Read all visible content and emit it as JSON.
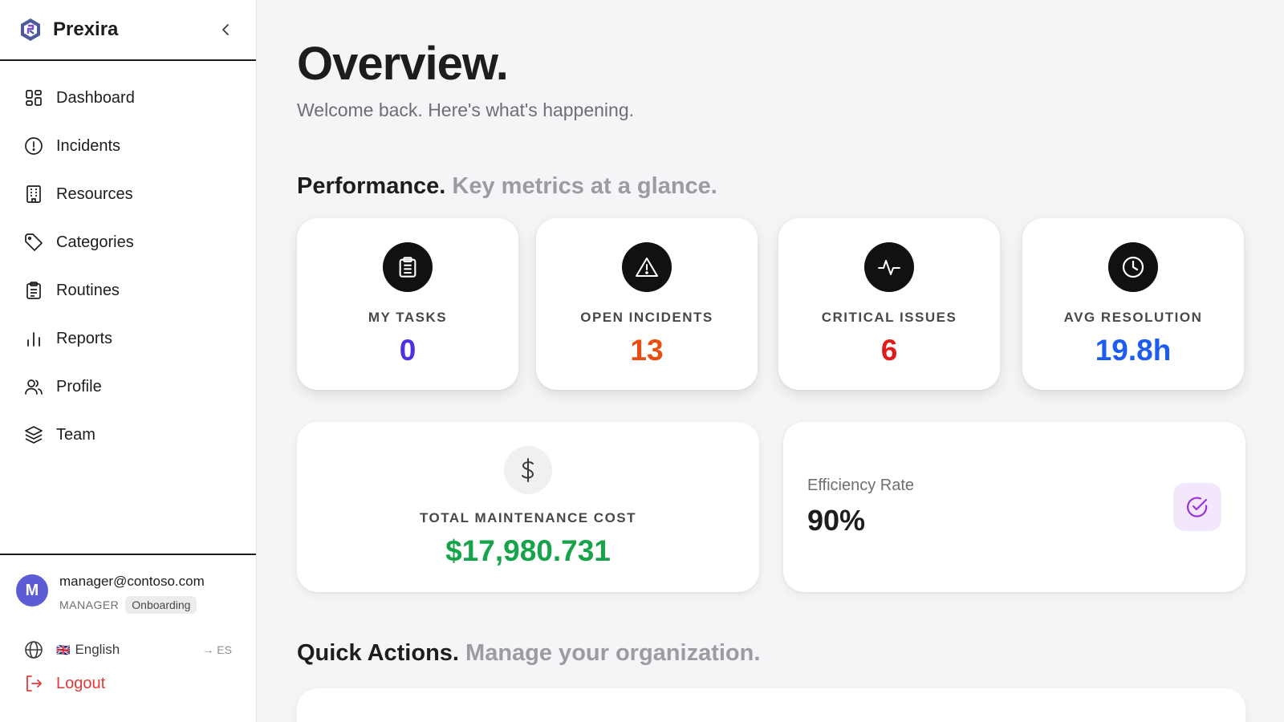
{
  "app": {
    "name": "Prexira"
  },
  "sidebar": {
    "items": [
      {
        "label": "Dashboard",
        "icon": "dashboard-icon"
      },
      {
        "label": "Incidents",
        "icon": "alert-circle-icon"
      },
      {
        "label": "Resources",
        "icon": "building-icon"
      },
      {
        "label": "Categories",
        "icon": "tag-icon"
      },
      {
        "label": "Routines",
        "icon": "clipboard-icon"
      },
      {
        "label": "Reports",
        "icon": "bar-chart-icon"
      },
      {
        "label": "Profile",
        "icon": "users-icon"
      },
      {
        "label": "Team",
        "icon": "layers-icon"
      }
    ]
  },
  "user": {
    "avatar_letter": "M",
    "email": "manager@contoso.com",
    "role": "MANAGER",
    "badge": "Onboarding",
    "avatar_color": "#5b5bd6"
  },
  "language": {
    "flag": "🇬🇧",
    "label": "English",
    "switch": "→ ES"
  },
  "logout": {
    "label": "Logout",
    "color": "#e5383b"
  },
  "header": {
    "title": "Overview.",
    "subtitle": "Welcome back. Here's what's happening."
  },
  "performance": {
    "title": "Performance.",
    "subtitle": "Key metrics at a glance.",
    "stats": [
      {
        "label": "MY TASKS",
        "value": "0",
        "color": "#4f2ee6",
        "icon": "clipboard-icon"
      },
      {
        "label": "OPEN INCIDENTS",
        "value": "13",
        "color": "#ea4e0f",
        "icon": "warning-icon"
      },
      {
        "label": "CRITICAL ISSUES",
        "value": "6",
        "color": "#e01b1b",
        "icon": "activity-icon"
      },
      {
        "label": "AVG RESOLUTION",
        "value": "19.8h",
        "color": "#1d5cf0",
        "icon": "clock-icon"
      }
    ],
    "cost": {
      "label": "TOTAL MAINTENANCE COST",
      "value": "$17,980.731",
      "color": "#16a34a",
      "icon": "dollar-icon"
    },
    "efficiency": {
      "label": "Efficiency Rate",
      "value": "90%",
      "icon": "check-circle-icon",
      "accent": "#9b30d9"
    }
  },
  "quick_actions": {
    "title": "Quick Actions.",
    "subtitle": "Manage your organization."
  }
}
